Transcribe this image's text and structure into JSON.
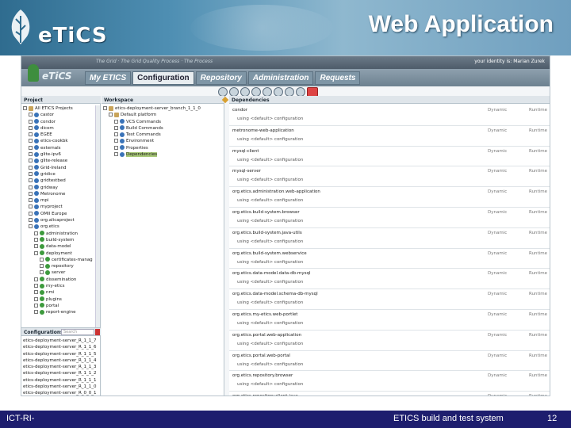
{
  "slide": {
    "title": "Web Application",
    "logo_text": "eTiCS",
    "footer_left": "ICT-RI-",
    "footer_center": "ETICS build and test system",
    "page_number": "12"
  },
  "app": {
    "slogan": "The Grid · The Grid Quality Process · The Process",
    "identity": "your identity is: Marian Zurek",
    "logo_text": "eTiCS",
    "tabs": [
      {
        "label": "My ETICS",
        "active": false
      },
      {
        "label": "Configuration",
        "active": true
      },
      {
        "label": "Repository",
        "active": false
      },
      {
        "label": "Administration",
        "active": false
      },
      {
        "label": "Requests",
        "active": false
      }
    ],
    "project_pane": {
      "header": "Project",
      "items": [
        {
          "label": "All ETICS Projects",
          "indent": 0,
          "icon": "f"
        },
        {
          "label": "castor",
          "indent": 1,
          "icon": "b"
        },
        {
          "label": "condor",
          "indent": 1,
          "icon": "b"
        },
        {
          "label": "dicom",
          "indent": 1,
          "icon": "b"
        },
        {
          "label": "EGEE",
          "indent": 1,
          "icon": "b"
        },
        {
          "label": "etics-cookbk",
          "indent": 1,
          "icon": "b"
        },
        {
          "label": "externals",
          "indent": 1,
          "icon": "b"
        },
        {
          "label": "glite-ipv6",
          "indent": 1,
          "icon": "b"
        },
        {
          "label": "glite-release",
          "indent": 1,
          "icon": "b"
        },
        {
          "label": "Grid-Ireland",
          "indent": 1,
          "icon": "b"
        },
        {
          "label": "gridice",
          "indent": 1,
          "icon": "b"
        },
        {
          "label": "gridtestbed",
          "indent": 1,
          "icon": "b"
        },
        {
          "label": "gridway",
          "indent": 1,
          "icon": "b"
        },
        {
          "label": "Metronome",
          "indent": 1,
          "icon": "b"
        },
        {
          "label": "mpi",
          "indent": 1,
          "icon": "b"
        },
        {
          "label": "myproject",
          "indent": 1,
          "icon": "b"
        },
        {
          "label": "OMII Europe",
          "indent": 1,
          "icon": "b"
        },
        {
          "label": "org.alicaproject",
          "indent": 1,
          "icon": "b"
        },
        {
          "label": "org.etics",
          "indent": 1,
          "icon": "b"
        },
        {
          "label": "administration",
          "indent": 2,
          "icon": "g"
        },
        {
          "label": "build-system",
          "indent": 2,
          "icon": "g"
        },
        {
          "label": "data-model",
          "indent": 2,
          "icon": "g"
        },
        {
          "label": "deployment",
          "indent": 2,
          "icon": "g"
        },
        {
          "label": "certificates-manag",
          "indent": 3,
          "icon": "g"
        },
        {
          "label": "repository",
          "indent": 3,
          "icon": "g"
        },
        {
          "label": "server",
          "indent": 3,
          "icon": "g"
        },
        {
          "label": "dissemination",
          "indent": 2,
          "icon": "g"
        },
        {
          "label": "my-etics",
          "indent": 2,
          "icon": "g"
        },
        {
          "label": "nmi",
          "indent": 2,
          "icon": "g"
        },
        {
          "label": "plugins",
          "indent": 2,
          "icon": "g"
        },
        {
          "label": "portal",
          "indent": 2,
          "icon": "g"
        },
        {
          "label": "report-engine",
          "indent": 2,
          "icon": "g"
        }
      ]
    },
    "config_pane": {
      "header": "Configurations",
      "search_placeholder": "Search",
      "items": [
        "etics-deployment-server_R_1_1_7",
        "etics-deployment-server_R_1_1_6",
        "etics-deployment-server_R_1_1_5",
        "etics-deployment-server_R_1_1_4",
        "etics-deployment-server_R_1_1_3",
        "etics-deployment-server_R_1_1_2",
        "etics-deployment-server_R_1_1_1",
        "etics-deployment-server_R_1_1_0",
        "etics-deployment-server_R_0_0_1",
        "etics-deployment-server_R_1_1_0",
        "org.etics.deployment.server_R_0_"
      ]
    },
    "workspace_pane": {
      "header": "Workspace",
      "items": [
        {
          "label": "etics-deployment-server_branch_1_1_0",
          "indent": 0,
          "icon": "f",
          "selected": false
        },
        {
          "label": "Default platform",
          "indent": 1,
          "icon": "f",
          "selected": false
        },
        {
          "label": "VCS Commands",
          "indent": 2,
          "icon": "b",
          "selected": false
        },
        {
          "label": "Build Commands",
          "indent": 2,
          "icon": "b",
          "selected": false
        },
        {
          "label": "Test Commands",
          "indent": 2,
          "icon": "b",
          "selected": false
        },
        {
          "label": "Environment",
          "indent": 2,
          "icon": "b",
          "selected": false
        },
        {
          "label": "Properties",
          "indent": 2,
          "icon": "b",
          "selected": false
        },
        {
          "label": "Dependencies",
          "indent": 2,
          "icon": "b",
          "selected": true
        }
      ]
    },
    "deps_pane": {
      "header": "Dependencies",
      "rows": [
        {
          "name": "condor",
          "config": "using <default> configuration",
          "type": "Dynamic",
          "scope": "Runtime"
        },
        {
          "name": "metronome-web-application",
          "config": "using <default> configuration",
          "type": "Dynamic",
          "scope": "Runtime"
        },
        {
          "name": "mysql-client",
          "config": "using <default> configuration",
          "type": "Dynamic",
          "scope": "Runtime"
        },
        {
          "name": "mysql-server",
          "config": "using <default> configuration",
          "type": "Dynamic",
          "scope": "Runtime"
        },
        {
          "name": "org.etics.administration.web-application",
          "config": "using <default> configuration",
          "type": "Dynamic",
          "scope": "Runtime"
        },
        {
          "name": "org.etics.build-system.browser",
          "config": "using <default> configuration",
          "type": "Dynamic",
          "scope": "Runtime"
        },
        {
          "name": "org.etics.build-system.java-utils",
          "config": "using <default> configuration",
          "type": "Dynamic",
          "scope": "Runtime"
        },
        {
          "name": "org.etics.build-system.webservice",
          "config": "using <default> configuration",
          "type": "Dynamic",
          "scope": "Runtime"
        },
        {
          "name": "org.etics.data-model.data-db-mysql",
          "config": "using <default> configuration",
          "type": "Dynamic",
          "scope": "Runtime"
        },
        {
          "name": "org.etics.data-model.schema-db-mysql",
          "config": "using <default> configuration",
          "type": "Dynamic",
          "scope": "Runtime"
        },
        {
          "name": "org.etics.my-etics.web-portlet",
          "config": "using <default> configuration",
          "type": "Dynamic",
          "scope": "Runtime"
        },
        {
          "name": "org.etics.portal.web-application",
          "config": "using <default> configuration",
          "type": "Dynamic",
          "scope": "Runtime"
        },
        {
          "name": "org.etics.portal.web-portal",
          "config": "using <default> configuration",
          "type": "Dynamic",
          "scope": "Runtime"
        },
        {
          "name": "org.etics.repository.browser",
          "config": "using <default> configuration",
          "type": "Dynamic",
          "scope": "Runtime"
        },
        {
          "name": "org.etics.repository.client-java",
          "config": "using <default> configuration",
          "type": "Dynamic",
          "scope": "Runtime"
        },
        {
          "name": "org.etics.tools.certificates",
          "config": "using <default> configuration",
          "type": "Dynamic",
          "scope": "Runtime"
        }
      ]
    }
  },
  "colors": {
    "footer_bg": "#1e1e6e",
    "selection": "#a9c979",
    "banner": "#4f8fb3"
  }
}
